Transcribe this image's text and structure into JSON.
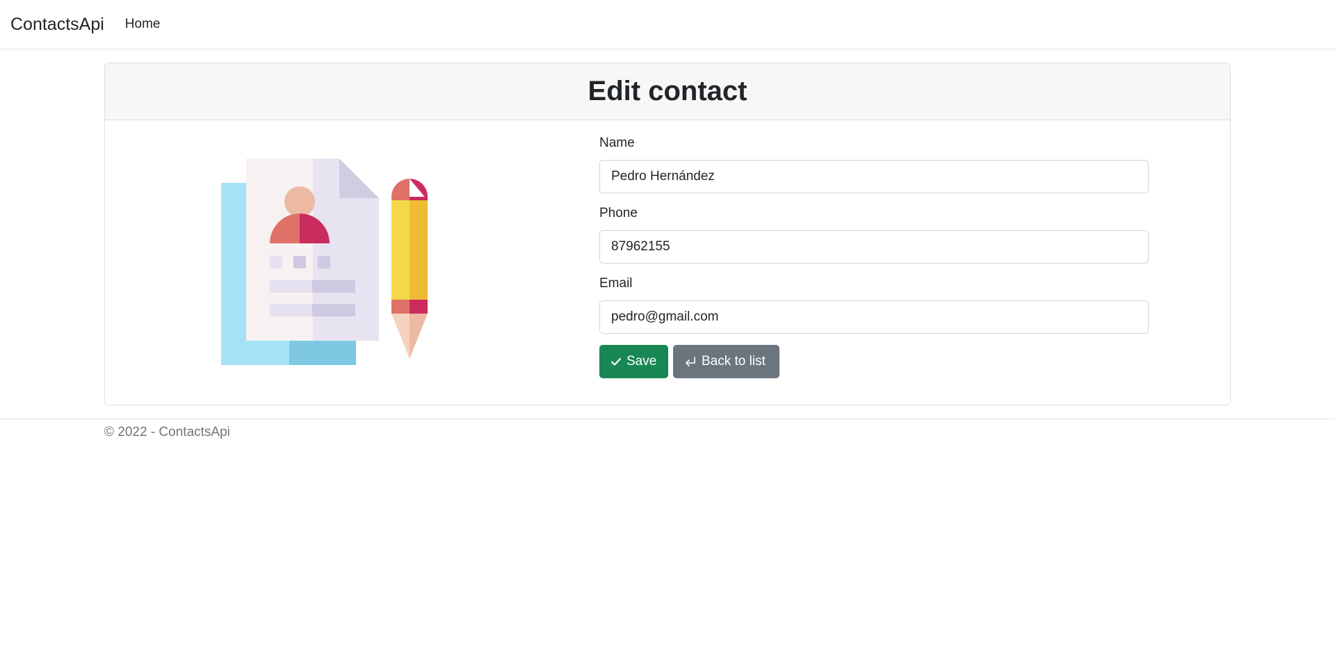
{
  "navbar": {
    "brand": "ContactsApi",
    "links": [
      {
        "label": "Home"
      }
    ]
  },
  "card": {
    "title": "Edit contact"
  },
  "form": {
    "name": {
      "label": "Name",
      "value": "Pedro Hernández"
    },
    "phone": {
      "label": "Phone",
      "value": "87962155"
    },
    "email": {
      "label": "Email",
      "value": "pedro@gmail.com"
    },
    "save_label": "Save",
    "back_label": "Back to list"
  },
  "illustration": {
    "icon": "contact-document-with-pencil"
  },
  "footer": {
    "text": "© 2022 - ContactsApi"
  },
  "colors": {
    "save_button": "#198754",
    "back_button": "#6c757d"
  }
}
